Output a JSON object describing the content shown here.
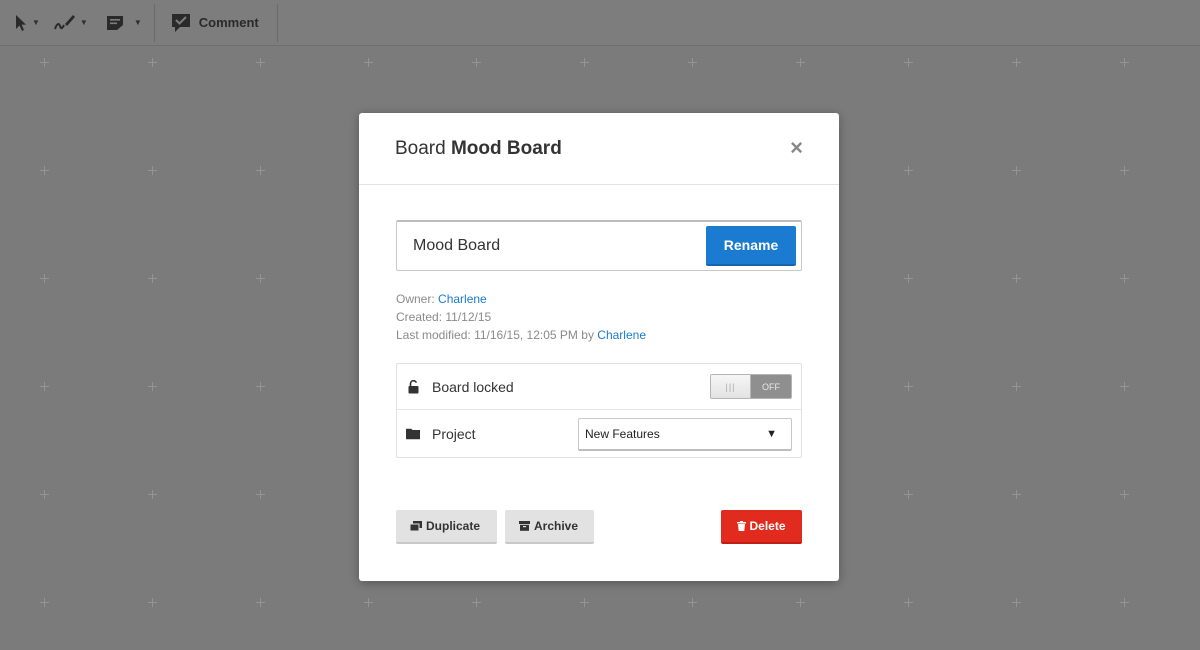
{
  "toolbar": {
    "tools": [
      {
        "icon": "pointer-icon"
      },
      {
        "icon": "pen-icon"
      },
      {
        "icon": "sticky-note-icon"
      }
    ],
    "comment_label": "Comment"
  },
  "modal": {
    "title_prefix": "Board",
    "title_name": "Mood Board",
    "close_glyph": "×",
    "rename": {
      "value": "Mood Board",
      "button_label": "Rename"
    },
    "meta": {
      "owner_label": "Owner:",
      "owner_name": "Charlene",
      "created_label": "Created:",
      "created_value": "11/12/15",
      "modified_label": "Last modified:",
      "modified_value": "11/16/15, 12:05 PM",
      "modified_by_label": "by",
      "modified_by_name": "Charlene"
    },
    "settings": {
      "locked_label": "Board locked",
      "locked_state": "OFF",
      "project_label": "Project",
      "project_selected": "New Features"
    },
    "actions": {
      "duplicate_label": "Duplicate",
      "archive_label": "Archive",
      "delete_label": "Delete"
    }
  },
  "colors": {
    "accent": "#1a7bd0",
    "danger": "#e12b1e",
    "backdrop": "#7b7b7b"
  }
}
